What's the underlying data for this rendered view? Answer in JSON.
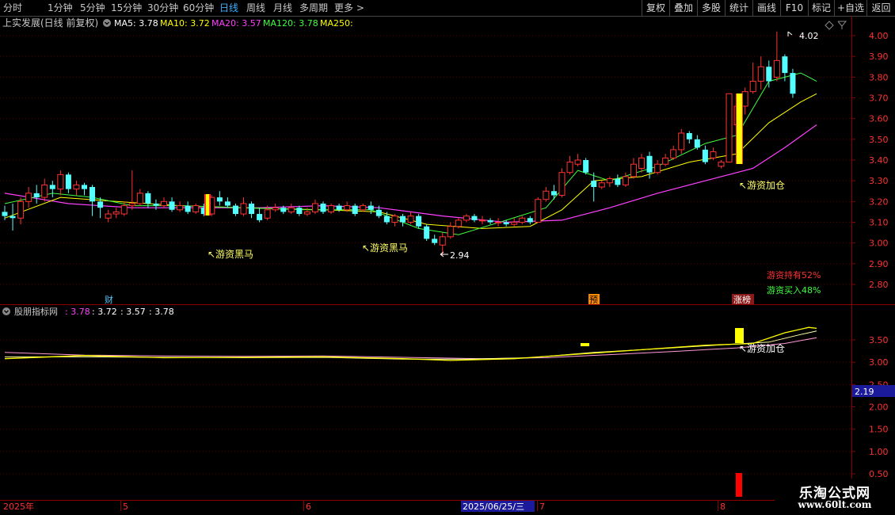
{
  "toolbar": {
    "periods": [
      "分时",
      "1分钟",
      "5分钟",
      "15分钟",
      "30分钟",
      "60分钟",
      "日线",
      "周线",
      "月线",
      "多周期",
      "更多 >"
    ],
    "active_period": "日线",
    "right_buttons": [
      "复权",
      "叠加",
      "多股",
      "统计",
      "画线",
      "F10",
      "标记",
      "+自选",
      "返回"
    ]
  },
  "main_panel": {
    "title": "上实发展(日线 前复权)",
    "ma_labels": [
      {
        "text": "MA5: 3.78",
        "color": "#ffffff"
      },
      {
        "text": "MA10: 3.72",
        "color": "#ffff00"
      },
      {
        "text": "MA20: 3.57",
        "color": "#ff40ff"
      },
      {
        "text": "MA120: 3.78",
        "color": "#40ff40"
      },
      {
        "text": "MA250:",
        "color": "#ffff00"
      }
    ],
    "y_ticks": [
      "4.00",
      "3.90",
      "3.80",
      "3.70",
      "3.60",
      "3.50",
      "3.40",
      "3.30",
      "3.20",
      "3.10",
      "3.00",
      "2.90",
      "2.80"
    ],
    "high_label": "4.02",
    "low_label": "2.94",
    "annotations": [
      "游资黑马",
      "游资黑马",
      "游资加仓"
    ],
    "markers": [
      "财",
      "预",
      "涨榜"
    ],
    "stat_hold": "游资持有52%",
    "stat_buy": "游资买入48%"
  },
  "sub_panel": {
    "title": "股朋指标网",
    "values": [
      {
        "text": ": 3.78",
        "color": "#ff40ff"
      },
      {
        "text": ": 3.72",
        "color": "#ffffff"
      },
      {
        "text": ": 3.57",
        "color": "#ffffff"
      },
      {
        "text": ": 3.78",
        "color": "#ffffff"
      }
    ],
    "y_ticks": [
      "3.50",
      "3.00",
      "2.50",
      "2.00",
      "1.50",
      "1.00",
      "0.50"
    ],
    "price_box": "2.19",
    "annotation": "游资加仓"
  },
  "x_axis": {
    "labels": [
      "2025年",
      "5",
      "6",
      "2025/06/25/三",
      "7",
      "8"
    ]
  },
  "colors": {
    "up": "#ff3232",
    "down": "#54ffff",
    "ma5": "#ffffff",
    "ma10": "#ffff00",
    "ma20": "#ff40ff",
    "ma120": "#40ff40",
    "accent": "#3ab0ff",
    "grid": "#8b0000"
  },
  "candles": [
    [
      3.15,
      3.13,
      3.18,
      3.11
    ],
    [
      3.13,
      3.12,
      3.19,
      3.06
    ],
    [
      3.12,
      3.2,
      3.22,
      3.09
    ],
    [
      3.2,
      3.24,
      3.27,
      3.17
    ],
    [
      3.24,
      3.22,
      3.28,
      3.19
    ],
    [
      3.22,
      3.28,
      3.31,
      3.2
    ],
    [
      3.28,
      3.26,
      3.3,
      3.22
    ],
    [
      3.26,
      3.33,
      3.35,
      3.23
    ],
    [
      3.33,
      3.26,
      3.34,
      3.24
    ],
    [
      3.26,
      3.28,
      3.3,
      3.23
    ],
    [
      3.28,
      3.26,
      3.29,
      3.23
    ],
    [
      3.27,
      3.2,
      3.28,
      3.13
    ],
    [
      3.2,
      3.17,
      3.22,
      3.12
    ],
    [
      3.12,
      3.14,
      3.16,
      3.1
    ],
    [
      3.14,
      3.15,
      3.17,
      3.12
    ],
    [
      3.14,
      3.18,
      3.2,
      3.13
    ],
    [
      3.18,
      3.19,
      3.35,
      3.16
    ],
    [
      3.19,
      3.24,
      3.26,
      3.18
    ],
    [
      3.24,
      3.19,
      3.25,
      3.17
    ],
    [
      3.19,
      3.18,
      3.21,
      3.16
    ],
    [
      3.18,
      3.2,
      3.22,
      3.17
    ],
    [
      3.2,
      3.16,
      3.22,
      3.15
    ],
    [
      3.16,
      3.18,
      3.2,
      3.15
    ],
    [
      3.18,
      3.15,
      3.2,
      3.14
    ],
    [
      3.15,
      3.18,
      3.19,
      3.14
    ],
    [
      3.17,
      3.14,
      3.19,
      3.13
    ],
    [
      3.14,
      3.22,
      3.23,
      3.13
    ],
    [
      3.22,
      3.2,
      3.25,
      3.18
    ],
    [
      3.2,
      3.18,
      3.22,
      3.17
    ],
    [
      3.18,
      3.14,
      3.19,
      3.13
    ],
    [
      3.14,
      3.19,
      3.22,
      3.13
    ],
    [
      3.19,
      3.14,
      3.2,
      3.12
    ],
    [
      3.14,
      3.11,
      3.17,
      3.1
    ],
    [
      3.12,
      3.16,
      3.18,
      3.11
    ],
    [
      3.16,
      3.17,
      3.19,
      3.15
    ],
    [
      3.17,
      3.15,
      3.18,
      3.14
    ],
    [
      3.15,
      3.17,
      3.19,
      3.14
    ],
    [
      3.17,
      3.14,
      3.18,
      3.13
    ],
    [
      3.14,
      3.15,
      3.17,
      3.13
    ],
    [
      3.15,
      3.19,
      3.21,
      3.14
    ],
    [
      3.19,
      3.15,
      3.2,
      3.14
    ],
    [
      3.15,
      3.18,
      3.19,
      3.14
    ],
    [
      3.18,
      3.16,
      3.19,
      3.15
    ],
    [
      3.16,
      3.18,
      3.2,
      3.15
    ],
    [
      3.18,
      3.14,
      3.19,
      3.13
    ],
    [
      3.16,
      3.18,
      3.19,
      3.15
    ],
    [
      3.18,
      3.16,
      3.2,
      3.14
    ],
    [
      3.16,
      3.13,
      3.18,
      3.12
    ],
    [
      3.13,
      3.1,
      3.15,
      3.09
    ],
    [
      3.1,
      3.13,
      3.14,
      3.08
    ],
    [
      3.13,
      3.1,
      3.14,
      3.08
    ],
    [
      3.1,
      3.13,
      3.15,
      3.09
    ],
    [
      3.13,
      3.08,
      3.14,
      3.07
    ],
    [
      3.08,
      3.02,
      3.09,
      3.01
    ],
    [
      3.02,
      3.0,
      3.04,
      2.99
    ],
    [
      2.99,
      3.03,
      3.05,
      2.94
    ],
    [
      3.03,
      3.08,
      3.1,
      3.02
    ],
    [
      3.08,
      3.11,
      3.12,
      3.07
    ],
    [
      3.11,
      3.13,
      3.14,
      3.1
    ],
    [
      3.13,
      3.11,
      3.14,
      3.1
    ],
    [
      3.11,
      3.11,
      3.13,
      3.09
    ],
    [
      3.11,
      3.1,
      3.12,
      3.09
    ],
    [
      3.1,
      3.1,
      3.12,
      3.08
    ],
    [
      3.1,
      3.09,
      3.11,
      3.08
    ],
    [
      3.09,
      3.1,
      3.12,
      3.08
    ],
    [
      3.1,
      3.12,
      3.13,
      3.09
    ],
    [
      3.12,
      3.1,
      3.13,
      3.09
    ],
    [
      3.1,
      3.21,
      3.22,
      3.1
    ],
    [
      3.21,
      3.25,
      3.27,
      3.2
    ],
    [
      3.25,
      3.23,
      3.28,
      3.21
    ],
    [
      3.23,
      3.34,
      3.36,
      3.22
    ],
    [
      3.34,
      3.39,
      3.42,
      3.33
    ],
    [
      3.38,
      3.4,
      3.43,
      3.37
    ],
    [
      3.4,
      3.34,
      3.41,
      3.33
    ],
    [
      3.3,
      3.27,
      3.34,
      3.2
    ],
    [
      3.27,
      3.29,
      3.3,
      3.26
    ],
    [
      3.29,
      3.31,
      3.32,
      3.27
    ],
    [
      3.31,
      3.28,
      3.33,
      3.27
    ],
    [
      3.28,
      3.32,
      3.34,
      3.27
    ],
    [
      3.32,
      3.38,
      3.41,
      3.31
    ],
    [
      3.36,
      3.41,
      3.43,
      3.34
    ],
    [
      3.42,
      3.34,
      3.44,
      3.31
    ],
    [
      3.34,
      3.38,
      3.4,
      3.33
    ],
    [
      3.38,
      3.41,
      3.43,
      3.37
    ],
    [
      3.41,
      3.45,
      3.47,
      3.4
    ],
    [
      3.45,
      3.53,
      3.55,
      3.43
    ],
    [
      3.53,
      3.5,
      3.54,
      3.48
    ],
    [
      3.5,
      3.46,
      3.52,
      3.45
    ],
    [
      3.45,
      3.39,
      3.47,
      3.38
    ],
    [
      3.41,
      3.44,
      3.46,
      3.4
    ],
    [
      3.37,
      3.39,
      3.4,
      3.36
    ],
    [
      3.39,
      3.72,
      3.72,
      3.39
    ],
    [
      3.57,
      3.66,
      3.7,
      3.55
    ],
    [
      3.66,
      3.73,
      3.75,
      3.62
    ],
    [
      3.73,
      3.78,
      3.87,
      3.72
    ],
    [
      3.78,
      3.85,
      3.9,
      3.74
    ],
    [
      3.85,
      3.78,
      3.88,
      3.75
    ],
    [
      3.8,
      3.88,
      4.02,
      3.78
    ],
    [
      3.9,
      3.82,
      3.91,
      3.78
    ],
    [
      3.82,
      3.72,
      3.84,
      3.7
    ]
  ],
  "ma": {
    "ma5": [
      [
        0,
        3.19
      ],
      [
        6,
        3.24
      ],
      [
        11,
        3.22
      ],
      [
        16,
        3.18
      ],
      [
        22,
        3.18
      ],
      [
        30,
        3.17
      ],
      [
        38,
        3.16
      ],
      [
        46,
        3.16
      ],
      [
        52,
        3.07
      ],
      [
        57,
        3.04
      ],
      [
        63,
        3.11
      ],
      [
        68,
        3.17
      ],
      [
        72,
        3.35
      ],
      [
        76,
        3.3
      ],
      [
        82,
        3.37
      ],
      [
        88,
        3.48
      ],
      [
        92,
        3.52
      ],
      [
        96,
        3.78
      ],
      [
        100,
        3.82
      ],
      [
        102,
        3.78
      ]
    ],
    "ma10": [
      [
        0,
        3.12
      ],
      [
        7,
        3.22
      ],
      [
        14,
        3.2
      ],
      [
        22,
        3.18
      ],
      [
        30,
        3.17
      ],
      [
        40,
        3.16
      ],
      [
        47,
        3.15
      ],
      [
        53,
        3.09
      ],
      [
        60,
        3.07
      ],
      [
        66,
        3.08
      ],
      [
        70,
        3.16
      ],
      [
        74,
        3.3
      ],
      [
        80,
        3.32
      ],
      [
        86,
        3.39
      ],
      [
        92,
        3.43
      ],
      [
        96,
        3.58
      ],
      [
        100,
        3.68
      ],
      [
        102,
        3.72
      ]
    ],
    "ma20": [
      [
        0,
        3.24
      ],
      [
        8,
        3.19
      ],
      [
        16,
        3.17
      ],
      [
        24,
        3.17
      ],
      [
        32,
        3.17
      ],
      [
        40,
        3.18
      ],
      [
        47,
        3.17
      ],
      [
        55,
        3.13
      ],
      [
        63,
        3.1
      ],
      [
        70,
        3.11
      ],
      [
        76,
        3.17
      ],
      [
        82,
        3.24
      ],
      [
        88,
        3.3
      ],
      [
        94,
        3.36
      ],
      [
        98,
        3.46
      ],
      [
        102,
        3.57
      ]
    ]
  },
  "sub_lines": {
    "line_a": [
      [
        0,
        3.08
      ],
      [
        10,
        3.15
      ],
      [
        20,
        3.1
      ],
      [
        30,
        3.11
      ],
      [
        40,
        3.12
      ],
      [
        50,
        3.08
      ],
      [
        56,
        3.04
      ],
      [
        64,
        3.08
      ],
      [
        72,
        3.18
      ],
      [
        80,
        3.28
      ],
      [
        88,
        3.38
      ],
      [
        94,
        3.42
      ],
      [
        98,
        3.66
      ],
      [
        101,
        3.78
      ],
      [
        102,
        3.76
      ]
    ],
    "line_b": [
      [
        0,
        3.12
      ],
      [
        10,
        3.12
      ],
      [
        20,
        3.11
      ],
      [
        30,
        3.1
      ],
      [
        40,
        3.11
      ],
      [
        50,
        3.07
      ],
      [
        58,
        3.07
      ],
      [
        66,
        3.1
      ],
      [
        74,
        3.22
      ],
      [
        82,
        3.3
      ],
      [
        90,
        3.39
      ],
      [
        96,
        3.45
      ],
      [
        100,
        3.62
      ],
      [
        102,
        3.7
      ]
    ],
    "line_c": [
      [
        0,
        3.22
      ],
      [
        10,
        3.16
      ],
      [
        20,
        3.14
      ],
      [
        30,
        3.13
      ],
      [
        40,
        3.14
      ],
      [
        50,
        3.11
      ],
      [
        60,
        3.08
      ],
      [
        68,
        3.1
      ],
      [
        76,
        3.17
      ],
      [
        84,
        3.24
      ],
      [
        92,
        3.32
      ],
      [
        98,
        3.42
      ],
      [
        102,
        3.55
      ]
    ]
  }
}
